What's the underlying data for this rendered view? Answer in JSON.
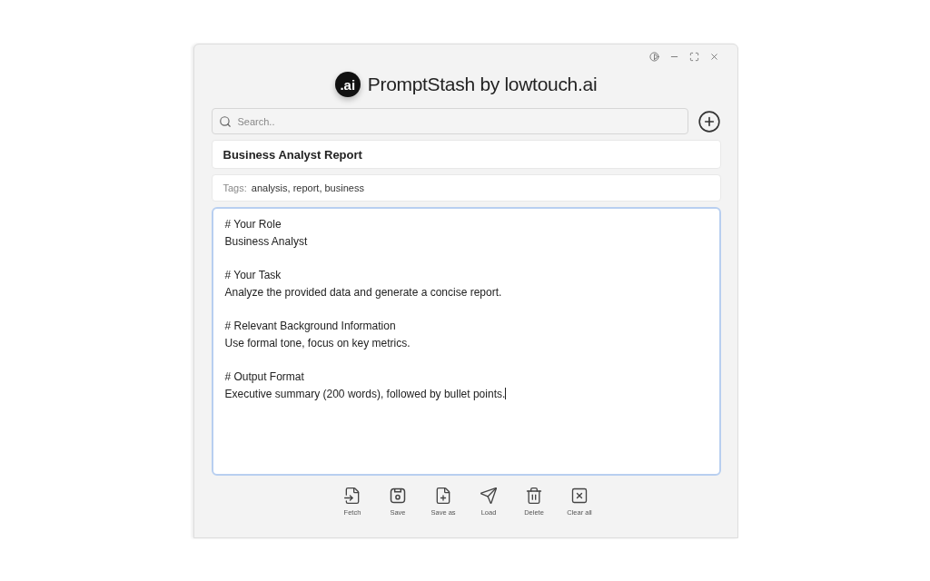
{
  "window": {
    "controls": [
      {
        "kind": "theme"
      },
      {
        "kind": "minimize"
      },
      {
        "kind": "maximize"
      },
      {
        "kind": "close"
      }
    ]
  },
  "header": {
    "logo": ".ai",
    "title": "PromptStash",
    "byline": "by lowtouch.ai"
  },
  "search": {
    "placeholder": "Search.."
  },
  "prompt_title": "Business Analyst Report",
  "tags": {
    "label": "Tags:",
    "value": "analysis, report, business"
  },
  "editor": {
    "focused": true,
    "sections": [
      {
        "heading": "# Your Role",
        "body": "Business Analyst"
      },
      {
        "heading": "# Your Task",
        "body": "Analyze the provided data and generate a concise report."
      },
      {
        "heading": "# Relevant Background Information",
        "body": "Use formal tone, focus on key metrics."
      },
      {
        "heading": "# Output Format",
        "body": "Executive summary (200 words), followed by bullet points."
      }
    ]
  },
  "actions": [
    {
      "kind": "fetch",
      "label": "Fetch"
    },
    {
      "kind": "save",
      "label": "Save"
    },
    {
      "kind": "save_as",
      "label": "Save as"
    },
    {
      "kind": "load",
      "label": "Load"
    },
    {
      "kind": "delete",
      "label": "Delete"
    },
    {
      "kind": "clear",
      "label": "Clear all"
    }
  ]
}
